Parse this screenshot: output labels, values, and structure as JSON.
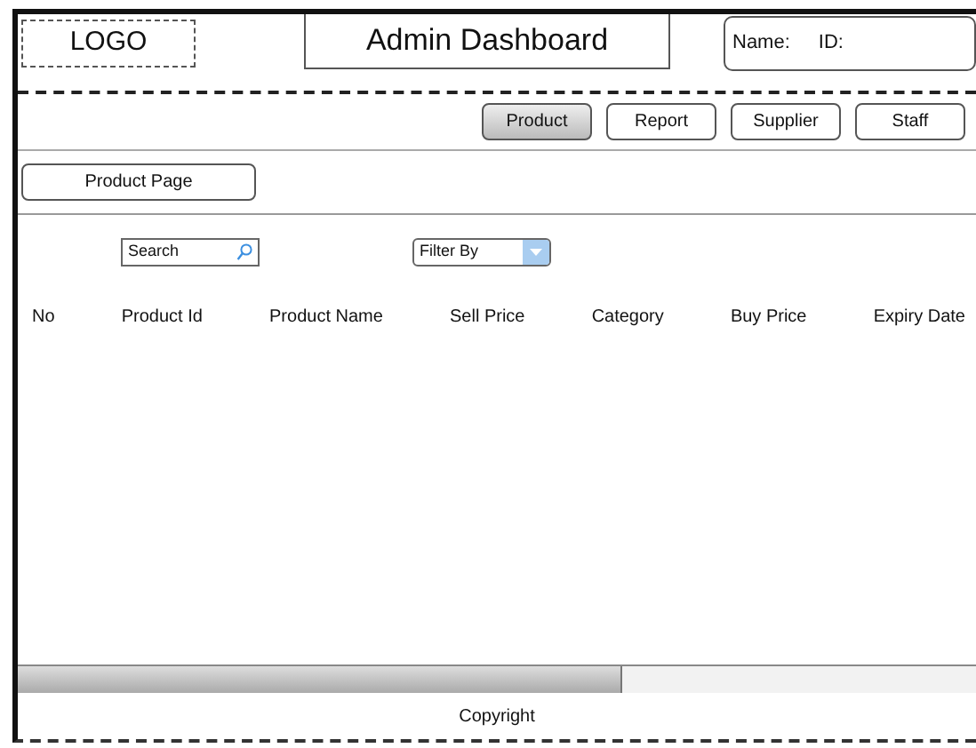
{
  "header": {
    "logo": "LOGO",
    "title": "Admin Dashboard",
    "user_labels": [
      "Name:",
      "ID:"
    ]
  },
  "nav": [
    {
      "label": "Product",
      "selected": true
    },
    {
      "label": "Report",
      "selected": false
    },
    {
      "label": "Supplier",
      "selected": false
    },
    {
      "label": "Staff",
      "selected": false
    }
  ],
  "page_button": "Product Page",
  "search": {
    "value": "Search"
  },
  "filter": {
    "value": "Filter By"
  },
  "table": {
    "columns": [
      "No",
      "Product Id",
      "Product Name",
      "Sell Price",
      "Category",
      "Buy Price",
      "Expiry Date"
    ]
  },
  "footer": "Copyright"
}
